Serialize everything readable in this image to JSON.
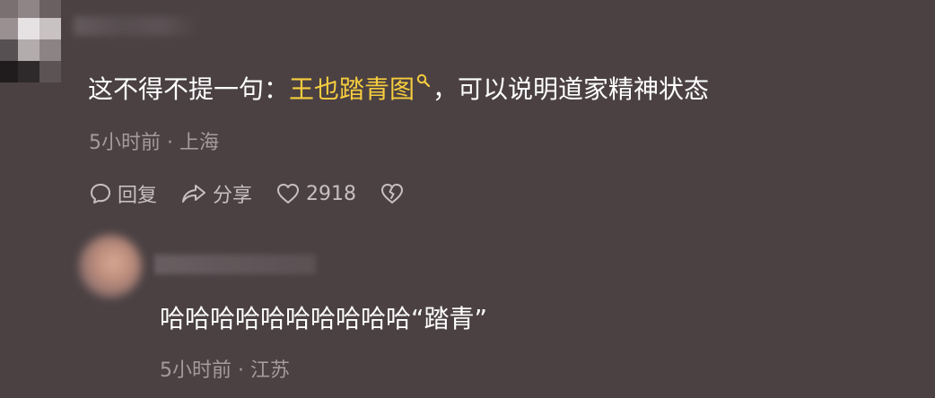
{
  "main_comment": {
    "text_before": "这不得不提一句：",
    "link_text": "王也踏青图",
    "text_after": "，可以说明道家精神状态",
    "time": "5小时前",
    "separator": "·",
    "location": "上海",
    "actions": {
      "reply_label": "回复",
      "share_label": "分享",
      "like_count": "2918"
    }
  },
  "reply": {
    "text": "哈哈哈哈哈哈哈哈哈哈“踏青”",
    "time": "5小时前",
    "separator": "·",
    "location": "江苏"
  },
  "colors": {
    "background": "#4b4143",
    "link": "#f6cd3e",
    "meta": "#a59a9c"
  },
  "icons": [
    "search-icon",
    "comment-icon",
    "share-icon",
    "heart-icon",
    "dislike-heart-icon"
  ]
}
